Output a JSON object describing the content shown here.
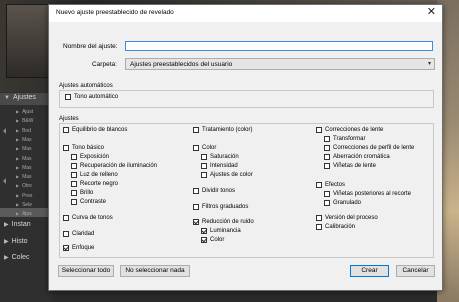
{
  "background": {
    "sections": [
      {
        "label": "Ajustes",
        "expanded": true
      },
      {
        "label": "Instan",
        "expanded": false
      },
      {
        "label": "Histo",
        "expanded": false
      },
      {
        "label": "Colec",
        "expanded": false
      }
    ],
    "preset_items": [
      "Ajust",
      "B&W",
      "Bod",
      "Mas",
      "Mas",
      "Mas",
      "Mas",
      "Mas",
      "Otro",
      "Pres",
      "Sele",
      "Ajus"
    ]
  },
  "dialog": {
    "title": "Nuevo ajuste preestablecido de revelado",
    "name_label": "Nombre del ajuste:",
    "name_value": "",
    "folder_label": "Carpeta:",
    "folder_value": "Ajustes preestablecidos del usuario",
    "auto_group": {
      "title": "Ajustes automáticos",
      "items": [
        {
          "label": "Tono automático",
          "checked": false
        }
      ]
    },
    "settings_group": {
      "title": "Ajustes",
      "col1": [
        {
          "label": "Equilibrio de blancos",
          "checked": false,
          "indent": 0
        },
        {
          "label": "Tono básico",
          "checked": false,
          "indent": 0
        },
        {
          "label": "Exposición",
          "checked": false,
          "indent": 1
        },
        {
          "label": "Recuperación de iluminación",
          "checked": false,
          "indent": 1
        },
        {
          "label": "Luz de relleno",
          "checked": false,
          "indent": 1
        },
        {
          "label": "Recorte negro",
          "checked": false,
          "indent": 1
        },
        {
          "label": "Brillo",
          "checked": false,
          "indent": 1
        },
        {
          "label": "Contraste",
          "checked": false,
          "indent": 1
        },
        {
          "label": "Curva de tonos",
          "checked": false,
          "indent": 0
        },
        {
          "label": "Claridad",
          "checked": false,
          "indent": 0
        },
        {
          "label": "Enfoque",
          "checked": true,
          "indent": 0
        }
      ],
      "col2": [
        {
          "label": "Tratamiento (color)",
          "checked": false,
          "indent": 0
        },
        {
          "label": "Color",
          "checked": false,
          "indent": 0
        },
        {
          "label": "Saturación",
          "checked": false,
          "indent": 1
        },
        {
          "label": "Intensidad",
          "checked": false,
          "indent": 1
        },
        {
          "label": "Ajustes de color",
          "checked": false,
          "indent": 1
        },
        {
          "label": "Dividir tonos",
          "checked": false,
          "indent": 0
        },
        {
          "label": "Filtros graduados",
          "checked": false,
          "indent": 0
        },
        {
          "label": "Reducción de ruido",
          "checked": true,
          "indent": 0
        },
        {
          "label": "Luminancia",
          "checked": true,
          "indent": 1
        },
        {
          "label": "Color",
          "checked": true,
          "indent": 1
        }
      ],
      "col3": [
        {
          "label": "Correcciones de lente",
          "checked": false,
          "indent": 0
        },
        {
          "label": "Transformar",
          "checked": false,
          "indent": 1
        },
        {
          "label": "Correcciones de perfil de lente",
          "checked": false,
          "indent": 1
        },
        {
          "label": "Aberración cromática",
          "checked": false,
          "indent": 1
        },
        {
          "label": "Viñetas de lente",
          "checked": false,
          "indent": 1
        },
        {
          "label": "Efectos",
          "checked": false,
          "indent": 0
        },
        {
          "label": "Viñetas posteriores al recorte",
          "checked": false,
          "indent": 1
        },
        {
          "label": "Granulado",
          "checked": false,
          "indent": 1
        },
        {
          "label": "Versión del proceso",
          "checked": false,
          "indent": 0
        },
        {
          "label": "Calibración",
          "checked": false,
          "indent": 0
        }
      ]
    },
    "buttons": {
      "select_all": "Seleccionar todo",
      "select_none": "No seleccionar nada",
      "create": "Crear",
      "cancel": "Cancelar"
    }
  },
  "colors": {
    "accent": "#0078d7",
    "dialog_bg": "#f0f0f0"
  }
}
